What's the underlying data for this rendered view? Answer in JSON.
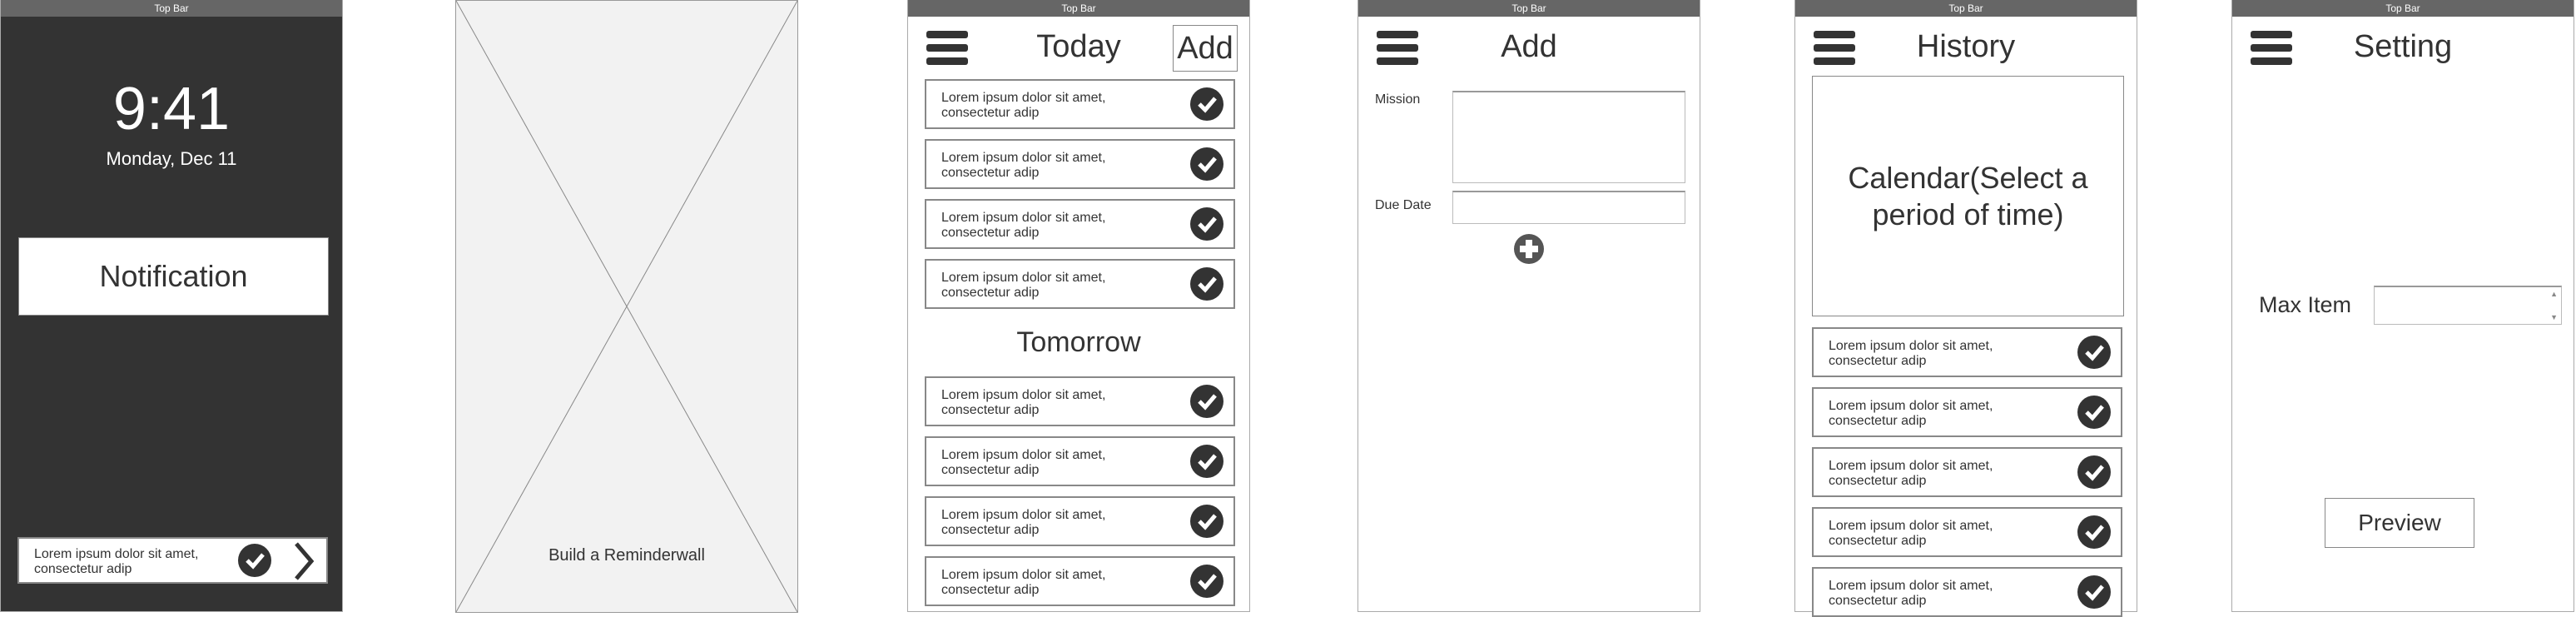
{
  "top_bar_label": "Top Bar",
  "lock_screen": {
    "time": "9:41",
    "date": "Monday, Dec 11",
    "notification": "Notification",
    "item_text": "Lorem ipsum dolor sit amet, consectetur adip"
  },
  "placeholder": {
    "caption": "Build a Reminderwall"
  },
  "today": {
    "title": "Today",
    "add_label": "Add",
    "section_tomorrow": "Tomorrow",
    "today_items": [
      "Lorem ipsum dolor sit amet, consectetur adip",
      "Lorem ipsum dolor sit amet, consectetur adip",
      "Lorem ipsum dolor sit amet, consectetur adip",
      "Lorem ipsum dolor sit amet, consectetur adip"
    ],
    "tomorrow_items": [
      "Lorem ipsum dolor sit amet, consectetur adip",
      "Lorem ipsum dolor sit amet, consectetur adip",
      "Lorem ipsum dolor sit amet, consectetur adip",
      "Lorem ipsum dolor sit amet, consectetur adip"
    ]
  },
  "add": {
    "title": "Add",
    "mission_label": "Mission",
    "mission_value": "",
    "due_date_label": "Due Date",
    "due_date_value": ""
  },
  "history": {
    "title": "History",
    "calendar_label": "Calendar(Select a period of time)",
    "items": [
      "Lorem ipsum dolor sit amet, consectetur adip",
      "Lorem ipsum dolor sit amet, consectetur adip",
      "Lorem ipsum dolor sit amet, consectetur adip",
      "Lorem ipsum dolor sit amet, consectetur adip",
      "Lorem ipsum dolor sit amet, consectetur adip"
    ]
  },
  "setting": {
    "title": "Setting",
    "max_item_label": "Max Item",
    "max_item_value": "",
    "preview_label": "Preview"
  },
  "colors": {
    "top_bar": "#666666",
    "lock_bg": "#333333",
    "icon": "#333333",
    "placeholder_bg": "#f2f2f2"
  }
}
